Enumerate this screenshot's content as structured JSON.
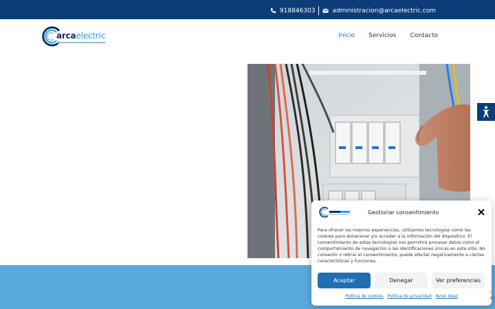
{
  "topbar": {
    "phone": "918846303",
    "email": "administracion@arcaelectric.com",
    "phone_icon": "phone-icon",
    "email_icon": "envelope-icon"
  },
  "logo": {
    "brand_dark": "arca",
    "brand_light": "electric"
  },
  "nav": {
    "items": [
      {
        "label": "Inicio",
        "active": true
      },
      {
        "label": "Servicios",
        "active": false
      },
      {
        "label": "Contacto",
        "active": false
      }
    ]
  },
  "hero": {
    "image_subject": "electrician hand on circuit breakers"
  },
  "accessibility": {
    "icon": "accessibility-icon"
  },
  "consent": {
    "title": "Gestionar consentimiento",
    "body": "Para ofrecer las mejores experiencias, utilizamos tecnologías como las cookies para almacenar y/o acceder a la información del dispositivo. El consentimiento de estas tecnologías nos permitirá procesar datos como el comportamiento de navegación o las identificaciones únicas en este sitio. No consentir o retirar el consentimiento, puede afectar negativamente a ciertas características y funciones.",
    "accept_label": "Aceptar",
    "deny_label": "Denegar",
    "preferences_label": "Ver preferencias",
    "links": [
      "Política de cookies",
      "Política de privacidad",
      "Aviso legal"
    ]
  },
  "recaptcha_peek": {
    "line1": "r",
    "line2": "do"
  },
  "colors": {
    "topbar": "#0c3d78",
    "accent": "#1f6fb3",
    "band": "#5aa9dc"
  }
}
